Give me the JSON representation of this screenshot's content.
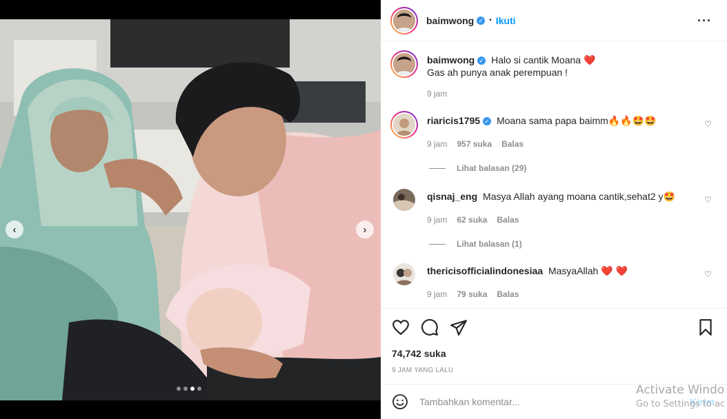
{
  "post": {
    "author": "baimwong",
    "follow_label": "Ikuti",
    "more_icon": "more-options-icon"
  },
  "caption": {
    "username": "baimwong",
    "line1": "Halo si cantik Moana",
    "line2": "Gas ah punya anak perempuan !",
    "time": "9 jam"
  },
  "comments": [
    {
      "username": "riaricis1795",
      "verified": true,
      "text": "Moana sama papa baimm🔥🔥🤩🤩",
      "time": "9 jam",
      "likes": "957 suka",
      "reply": "Balas",
      "view_replies": "Lihat balasan (29)"
    },
    {
      "username": "qisnaj_eng",
      "verified": false,
      "text": "Masya Allah ayang moana cantik,sehat2 y🤩",
      "time": "9 jam",
      "likes": "62 suka",
      "reply": "Balas",
      "view_replies": "Lihat balasan (1)"
    },
    {
      "username": "thericisofficialindonesiaa",
      "verified": false,
      "text": "MasyaAllah",
      "time": "9 jam",
      "likes": "79 suka",
      "reply": "Balas"
    }
  ],
  "actions": {
    "likes": "74,742 suka",
    "time_ago": "9 JAM YANG LALU"
  },
  "add_comment": {
    "placeholder": "Tambahkan komentar...",
    "post_label": "Kirim"
  },
  "watermark": {
    "line1": "Activate Windo",
    "line2": "Go to Settings to ac"
  },
  "carousel": {
    "slides": 4,
    "active_index": 2
  },
  "colors": {
    "accent": "#0095f6",
    "verified": "#3897f0",
    "heart": "#e0162b"
  }
}
